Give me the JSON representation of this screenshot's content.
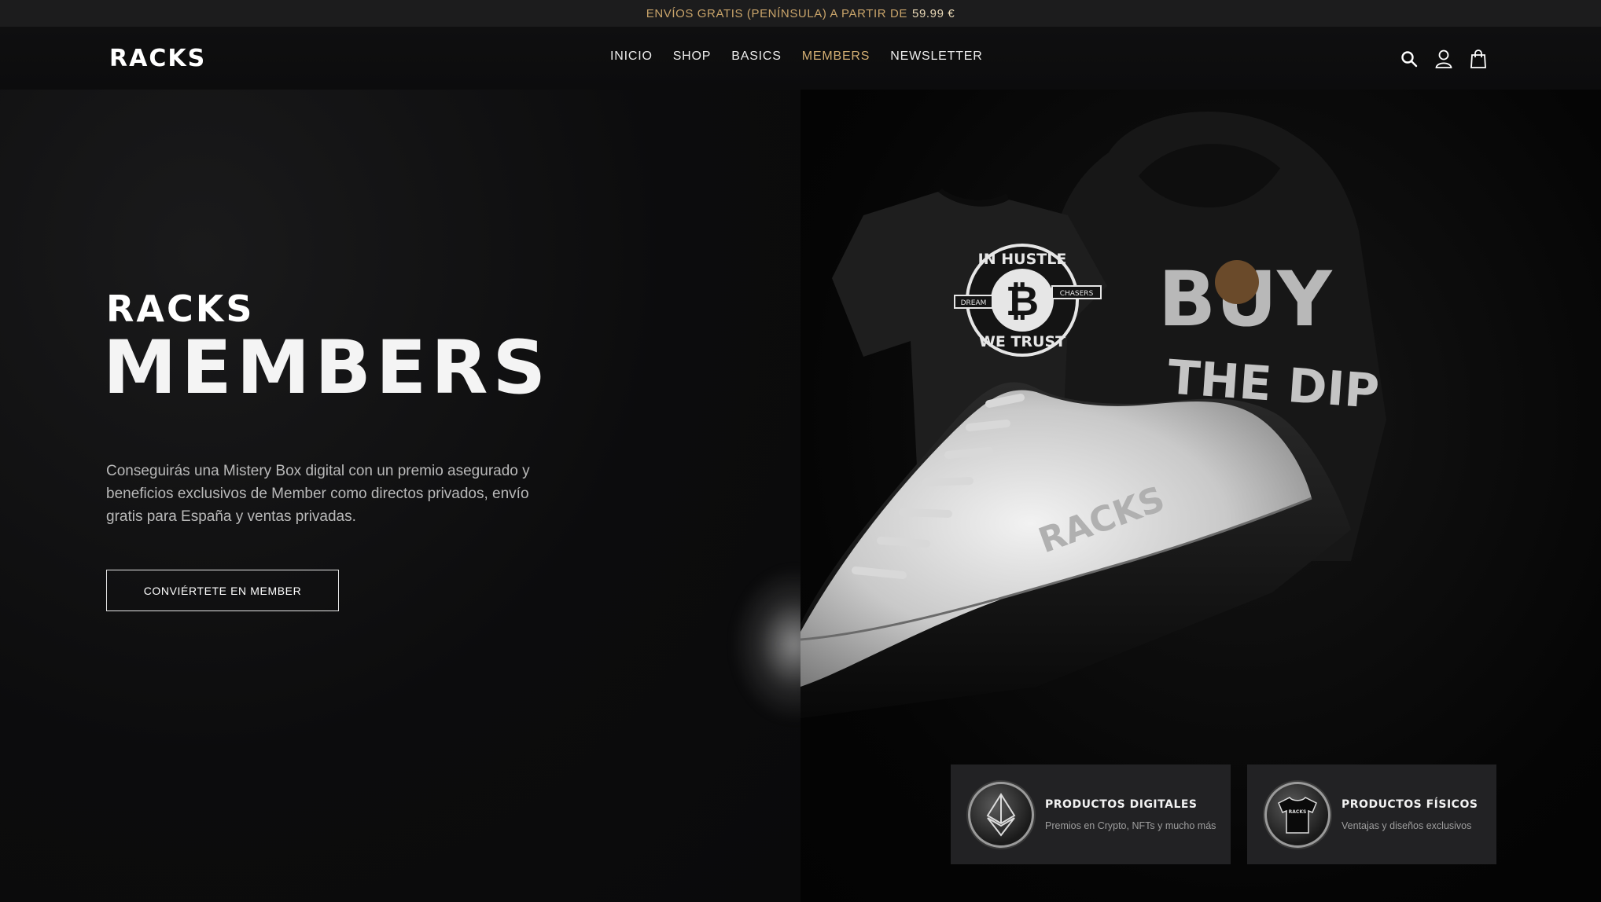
{
  "announcement": {
    "text": "ENVÍOS GRATIS (PENÍNSULA) A PARTIR DE",
    "price": "59.99 €"
  },
  "header": {
    "logo": "RACKS",
    "nav": [
      {
        "label": "INICIO"
      },
      {
        "label": "SHOP"
      },
      {
        "label": "BASICS"
      },
      {
        "label": "MEMBERS",
        "active": true
      },
      {
        "label": "NEWSLETTER"
      }
    ],
    "icons": [
      "search-icon",
      "account-icon",
      "cart-icon"
    ]
  },
  "hero": {
    "brand": "RACKS",
    "title": "MEMBERS",
    "description": "Conseguirás una Mistery Box digital con un premio asegurado y beneficios exclusivos de Member como directos privados, envío gratis para España y ventas privadas.",
    "cta_label": "CONVIÉRTETE EN MEMBER"
  },
  "product_image": {
    "tshirt_badge_top": "IN HUSTLE",
    "tshirt_badge_bottom": "WE TRUST",
    "tshirt_badge_left": "DREAM",
    "tshirt_badge_right": "CHASERS",
    "hoodie_text_1": "BUY",
    "hoodie_text_2": "THE DIP",
    "shoe_emboss": "RACKS"
  },
  "features": [
    {
      "title": "PRODUCTOS DIGITALES",
      "subtitle": "Premios en Crypto, NFTs y mucho más",
      "icon": "ethereum-icon"
    },
    {
      "title": "PRODUCTOS FÍSICOS",
      "subtitle": "Ventajas y diseños exclusivos",
      "icon": "tshirt-icon",
      "icon_label": "RACKS"
    }
  ],
  "colors": {
    "accent_gold": "#d3ae73",
    "background": "#0b0b0c",
    "card_bg": "#222224"
  }
}
